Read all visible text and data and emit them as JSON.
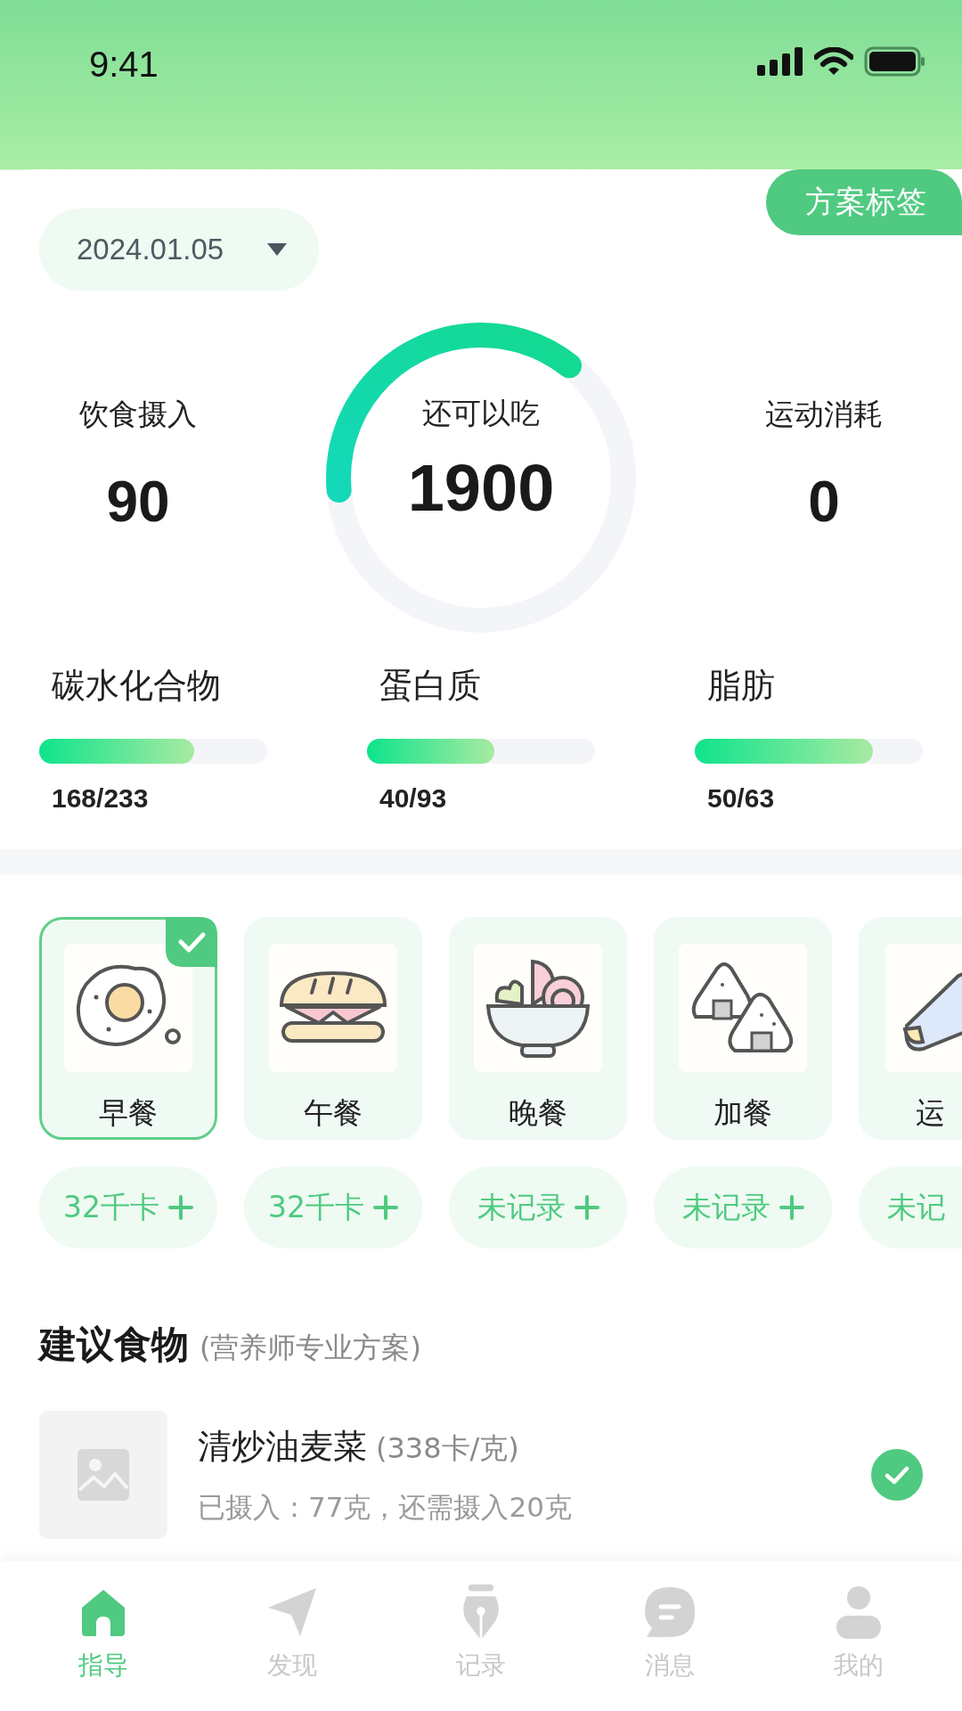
{
  "status_bar": {
    "time": "9:41"
  },
  "plan_tag": "方案标签",
  "date_picker": {
    "value": "2024.01.05"
  },
  "summary": {
    "intake": {
      "label": "饮食摄入",
      "value": "90"
    },
    "remaining": {
      "label": "还可以吃",
      "value": "1900",
      "level": 0.37
    },
    "burned": {
      "label": "运动消耗",
      "value": "0"
    }
  },
  "macros": [
    {
      "name": "碳水化合物",
      "level": 0.68,
      "reading": "168/233"
    },
    {
      "name": "蛋白质",
      "level": 0.56,
      "reading": "40/93"
    },
    {
      "name": "脂肪",
      "level": 0.78,
      "reading": "50/63"
    }
  ],
  "meals": [
    {
      "kind": "egg",
      "label": "早餐",
      "selected": true,
      "calories": "32千卡",
      "add_icon": true
    },
    {
      "kind": "sandwich",
      "label": "午餐",
      "selected": false,
      "calories": "32千卡",
      "add_icon": true
    },
    {
      "kind": "bowl",
      "label": "晚餐",
      "selected": false,
      "calories": "未记录",
      "add_icon": true
    },
    {
      "kind": "riceball",
      "label": "加餐",
      "selected": false,
      "calories": "未记录",
      "add_icon": true
    },
    {
      "kind": "shoe",
      "label": "运",
      "selected": false,
      "calories": "未记",
      "add_icon": false
    }
  ],
  "suggested": {
    "title": "建议食物",
    "subtitle": "(营养师专业方案)",
    "items": [
      {
        "name": "清炒油麦菜",
        "unit": "(338卡/克)",
        "detail": "已摄入：77克，还需摄入20克",
        "done": true
      }
    ]
  },
  "tab_bar": [
    {
      "kind": "home",
      "label": "指导",
      "selected": true
    },
    {
      "kind": "send",
      "label": "发现",
      "selected": false
    },
    {
      "kind": "pen",
      "label": "记录",
      "selected": false
    },
    {
      "kind": "chat",
      "label": "消息",
      "selected": false
    },
    {
      "kind": "person",
      "label": "我的",
      "selected": false
    }
  ]
}
